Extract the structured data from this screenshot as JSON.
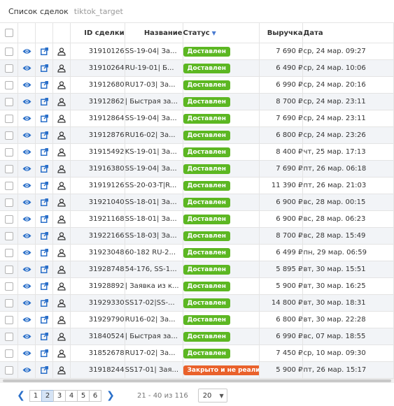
{
  "header": {
    "title": "Список сделок",
    "subtitle": "tiktok_target"
  },
  "columns": {
    "id": "ID сделки",
    "name": "Название",
    "status": "Статус",
    "revenue": "Выручка",
    "date": "Дата"
  },
  "status_colors": {
    "Доставлен": "#5cb722",
    "Закрыто и не реализов": "#e9612b"
  },
  "icon_color": "#2a6fc9",
  "rows": [
    {
      "id": "31910126",
      "name": "SS-19-04| За...",
      "status": "Доставлен",
      "revenue": "7 690 ₽",
      "date": "ср, 24 мар. 09:27"
    },
    {
      "id": "31910264",
      "name": "RU-19-01| Б...",
      "status": "Доставлен",
      "revenue": "6 490 ₽",
      "date": "ср, 24 мар. 10:06"
    },
    {
      "id": "31912680",
      "name": "RU17-03| За...",
      "status": "Доставлен",
      "revenue": "6 990 ₽",
      "date": "ср, 24 мар. 20:16"
    },
    {
      "id": "31912862",
      "name": "| Быстрая за...",
      "status": "Доставлен",
      "revenue": "8 700 ₽",
      "date": "ср, 24 мар. 23:11"
    },
    {
      "id": "31912864",
      "name": "SS-19-04| За...",
      "status": "Доставлен",
      "revenue": "7 690 ₽",
      "date": "ср, 24 мар. 23:11"
    },
    {
      "id": "31912876",
      "name": "RU16-02| За...",
      "status": "Доставлен",
      "revenue": "6 800 ₽",
      "date": "ср, 24 мар. 23:26"
    },
    {
      "id": "31915492",
      "name": "KS-19-01| За...",
      "status": "Доставлен",
      "revenue": "8 400 ₽",
      "date": "чт, 25 мар. 17:13"
    },
    {
      "id": "31916380",
      "name": "SS-19-04| За...",
      "status": "Доставлен",
      "revenue": "7 690 ₽",
      "date": "пт, 26 мар. 06:18"
    },
    {
      "id": "31919126",
      "name": "SS-20-03-T|R...",
      "status": "Доставлен",
      "revenue": "11 390 ₽",
      "date": "пт, 26 мар. 21:03"
    },
    {
      "id": "31921040",
      "name": "SS-18-01| За...",
      "status": "Доставлен",
      "revenue": "6 900 ₽",
      "date": "вс, 28 мар. 00:15"
    },
    {
      "id": "31921168",
      "name": "SS-18-01| За...",
      "status": "Доставлен",
      "revenue": "6 900 ₽",
      "date": "вс, 28 мар. 06:23"
    },
    {
      "id": "31922166",
      "name": "SS-18-03| За...",
      "status": "Доставлен",
      "revenue": "8 700 ₽",
      "date": "вс, 28 мар. 15:49"
    },
    {
      "id": "31923048",
      "name": "60-182 RU-2...",
      "status": "Доставлен",
      "revenue": "6 499 ₽",
      "date": "пн, 29 мар. 06:59"
    },
    {
      "id": "31928748",
      "name": "54-176, SS-1...",
      "status": "Доставлен",
      "revenue": "5 895 ₽",
      "date": "вт, 30 мар. 15:51"
    },
    {
      "id": "31928892",
      "name": "| Заявка из к...",
      "status": "Доставлен",
      "revenue": "5 900 ₽",
      "date": "вт, 30 мар. 16:25"
    },
    {
      "id": "31929330",
      "name": "SS17-02|SS-...",
      "status": "Доставлен",
      "revenue": "14 800 ₽",
      "date": "вт, 30 мар. 18:31"
    },
    {
      "id": "31929790",
      "name": "RU16-02| За...",
      "status": "Доставлен",
      "revenue": "6 800 ₽",
      "date": "вт, 30 мар. 22:28"
    },
    {
      "id": "31840524",
      "name": "| Быстрая за...",
      "status": "Доставлен",
      "revenue": "6 990 ₽",
      "date": "вс, 07 мар. 18:55"
    },
    {
      "id": "31852678",
      "name": "RU17-02| За...",
      "status": "Доставлен",
      "revenue": "7 450 ₽",
      "date": "ср, 10 мар. 09:30"
    },
    {
      "id": "31918244",
      "name": "SS17-01| Зая...",
      "status": "Закрыто и не реализов",
      "revenue": "5 900 ₽",
      "date": "пт, 26 мар. 15:17"
    }
  ],
  "pagination": {
    "pages": [
      "1",
      "2",
      "3",
      "4",
      "5",
      "6"
    ],
    "current": "2",
    "info": "21 - 40 из 116",
    "page_size": "20"
  }
}
